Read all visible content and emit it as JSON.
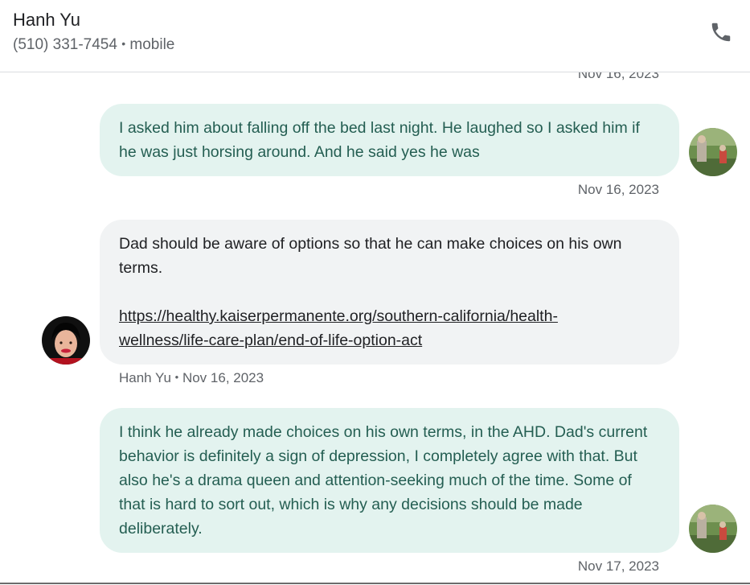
{
  "header": {
    "contact_name": "Hanh Yu",
    "phone_number": "(510) 331-7454",
    "separator": "•",
    "phone_type": "mobile",
    "call_icon": "phone-icon"
  },
  "messages": [
    {
      "direction": "outgoing",
      "text": "I asked him about falling off the bed last night. He laughed so I asked him if he was just horsing around. And he said yes he was",
      "timestamp": "Nov 16, 2023"
    },
    {
      "direction": "incoming",
      "sender": "Hanh Yu",
      "text": "Dad should be aware of options so that he can make choices on his own terms.",
      "link_line1": "https://healthy.kaiserpermanente.org/southern-california/health-",
      "link_line2": "wellness/life-care-plan/end-of-life-option-act",
      "timestamp": "Nov 16, 2023",
      "meta": "Hanh Yu • Nov 16, 2023"
    },
    {
      "direction": "outgoing",
      "text": "I think he already made choices on his own terms, in the AHD.  Dad's current behavior is definitely a sign of depression, I completely agree with that.  But also he's a drama queen and attention-seeking much of the time.  Some of that is hard to sort out, which is why any decisions should be made deliberately.",
      "timestamp": "Nov 17, 2023"
    }
  ],
  "previous_timestamp": "Nov 16, 2023",
  "colors": {
    "outgoing_bubble": "#e3f3ef",
    "outgoing_text": "#245e52",
    "incoming_bubble": "#f1f3f4",
    "meta_text": "#5f6368"
  }
}
